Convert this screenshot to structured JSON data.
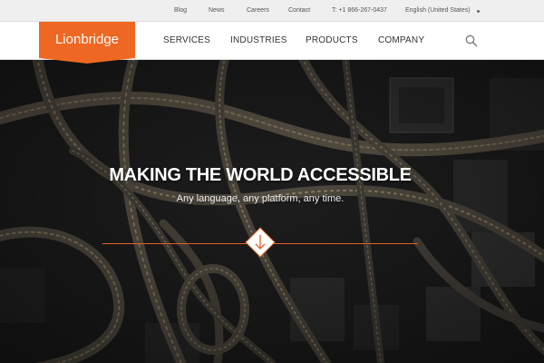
{
  "utility_nav": {
    "blog": "Blog",
    "news": "News",
    "careers": "Careers",
    "contact": "Contact",
    "phone": "T: +1 866-267-0437",
    "language": "English (United States)"
  },
  "header": {
    "logo": "Lionbridge",
    "nav": {
      "services": "SERVICES",
      "industries": "INDUSTRIES",
      "products": "PRODUCTS",
      "company": "COMPANY"
    },
    "search_icon": "search-icon"
  },
  "hero": {
    "headline": "MAKING THE WORLD ACCESSIBLE",
    "subline": "Any language, any platform, any time.",
    "scroll_icon": "arrow-down-icon"
  },
  "colors": {
    "brand_orange": "#ee6823",
    "rule_orange": "#e0612a"
  }
}
